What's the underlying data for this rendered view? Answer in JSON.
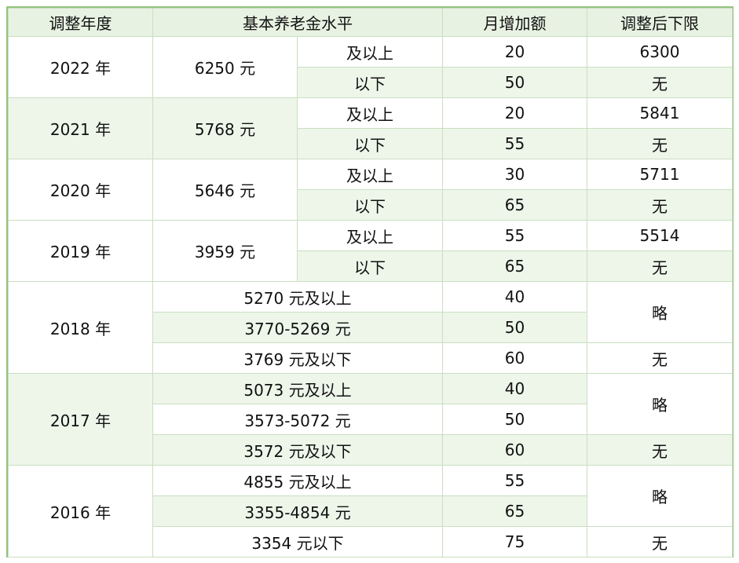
{
  "headers": [
    "调整年度",
    "基本养老金水平",
    "月增加额",
    "调整后下限"
  ],
  "rows": [
    {
      "year": "2022 年",
      "level": "6250 元",
      "rows": [
        {
          "range": "及以上",
          "increase": "20",
          "floor": "6300"
        },
        {
          "range": "以下",
          "increase": "50",
          "floor": "无"
        }
      ]
    },
    {
      "year": "2021 年",
      "level": "5768 元",
      "rows": [
        {
          "range": "及以上",
          "increase": "20",
          "floor": "5841"
        },
        {
          "range": "以下",
          "increase": "55",
          "floor": "无"
        }
      ]
    },
    {
      "year": "2020 年",
      "level": "5646 元",
      "rows": [
        {
          "range": "及以上",
          "increase": "30",
          "floor": "5711"
        },
        {
          "range": "以下",
          "increase": "65",
          "floor": "无"
        }
      ]
    },
    {
      "year": "2019 年",
      "level": "3959 元",
      "rows": [
        {
          "range": "及以上",
          "increase": "55",
          "floor": "5514"
        },
        {
          "range": "以下",
          "increase": "65",
          "floor": "无"
        }
      ]
    },
    {
      "year": "2018 年",
      "tiers": [
        {
          "level": "5270 元及以上",
          "increase": "40"
        },
        {
          "level": "3770-5269 元",
          "increase": "50"
        },
        {
          "level": "3769 元及以下",
          "increase": "60"
        }
      ],
      "floor_merged": "略",
      "floor_last": "无"
    },
    {
      "year": "2017 年",
      "tiers": [
        {
          "level": "5073 元及以上",
          "increase": "40"
        },
        {
          "level": "3573-5072 元",
          "increase": "50"
        },
        {
          "level": "3572 元及以下",
          "increase": "60"
        }
      ],
      "floor_merged": "略",
      "floor_last": "无"
    },
    {
      "year": "2016 年",
      "tiers": [
        {
          "level": "4855 元及以上",
          "increase": "55"
        },
        {
          "level": "3355-4854 元",
          "increase": "65"
        },
        {
          "level": "3354 元以下",
          "increase": "75"
        }
      ],
      "floor_merged": "略",
      "floor_last": "无"
    }
  ]
}
